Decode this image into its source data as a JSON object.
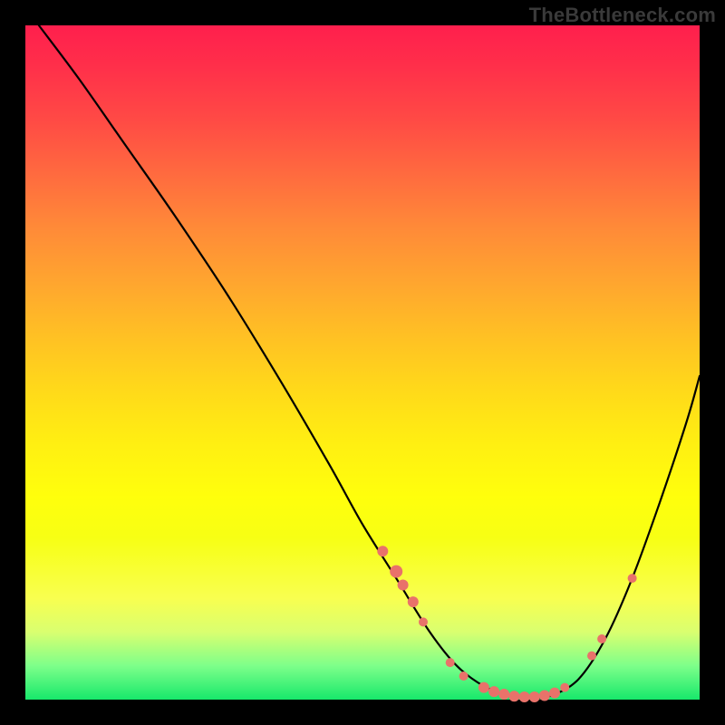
{
  "watermark": "TheBottleneck.com",
  "chart_data": {
    "type": "line",
    "title": "",
    "xlabel": "",
    "ylabel": "",
    "xlim": [
      0,
      100
    ],
    "ylim": [
      0,
      100
    ],
    "curve": {
      "name": "bottleneck-curve",
      "x": [
        2,
        8,
        15,
        22,
        30,
        38,
        45,
        50,
        55,
        60,
        64,
        68,
        72,
        75,
        78,
        82,
        86,
        90,
        94,
        98,
        100
      ],
      "y": [
        100,
        92,
        82,
        72,
        60,
        47,
        35,
        26,
        18,
        10,
        5,
        2,
        0.5,
        0.2,
        0.6,
        3,
        9,
        18,
        29,
        41,
        48
      ]
    },
    "markers": {
      "name": "highlight-points",
      "color": "#e9726a",
      "points": [
        {
          "x": 53,
          "y": 22,
          "r": 6
        },
        {
          "x": 55,
          "y": 19,
          "r": 7
        },
        {
          "x": 56,
          "y": 17,
          "r": 6
        },
        {
          "x": 57.5,
          "y": 14.5,
          "r": 6
        },
        {
          "x": 59,
          "y": 11.5,
          "r": 5
        },
        {
          "x": 63,
          "y": 5.5,
          "r": 5
        },
        {
          "x": 65,
          "y": 3.5,
          "r": 5
        },
        {
          "x": 68,
          "y": 1.8,
          "r": 6
        },
        {
          "x": 69.5,
          "y": 1.2,
          "r": 6
        },
        {
          "x": 71,
          "y": 0.8,
          "r": 6
        },
        {
          "x": 72.5,
          "y": 0.5,
          "r": 6
        },
        {
          "x": 74,
          "y": 0.4,
          "r": 6
        },
        {
          "x": 75.5,
          "y": 0.4,
          "r": 6
        },
        {
          "x": 77,
          "y": 0.6,
          "r": 6
        },
        {
          "x": 78.5,
          "y": 1.0,
          "r": 6
        },
        {
          "x": 80,
          "y": 1.8,
          "r": 5
        },
        {
          "x": 84,
          "y": 6.5,
          "r": 5
        },
        {
          "x": 85.5,
          "y": 9,
          "r": 5
        },
        {
          "x": 90,
          "y": 18,
          "r": 5
        }
      ]
    }
  }
}
